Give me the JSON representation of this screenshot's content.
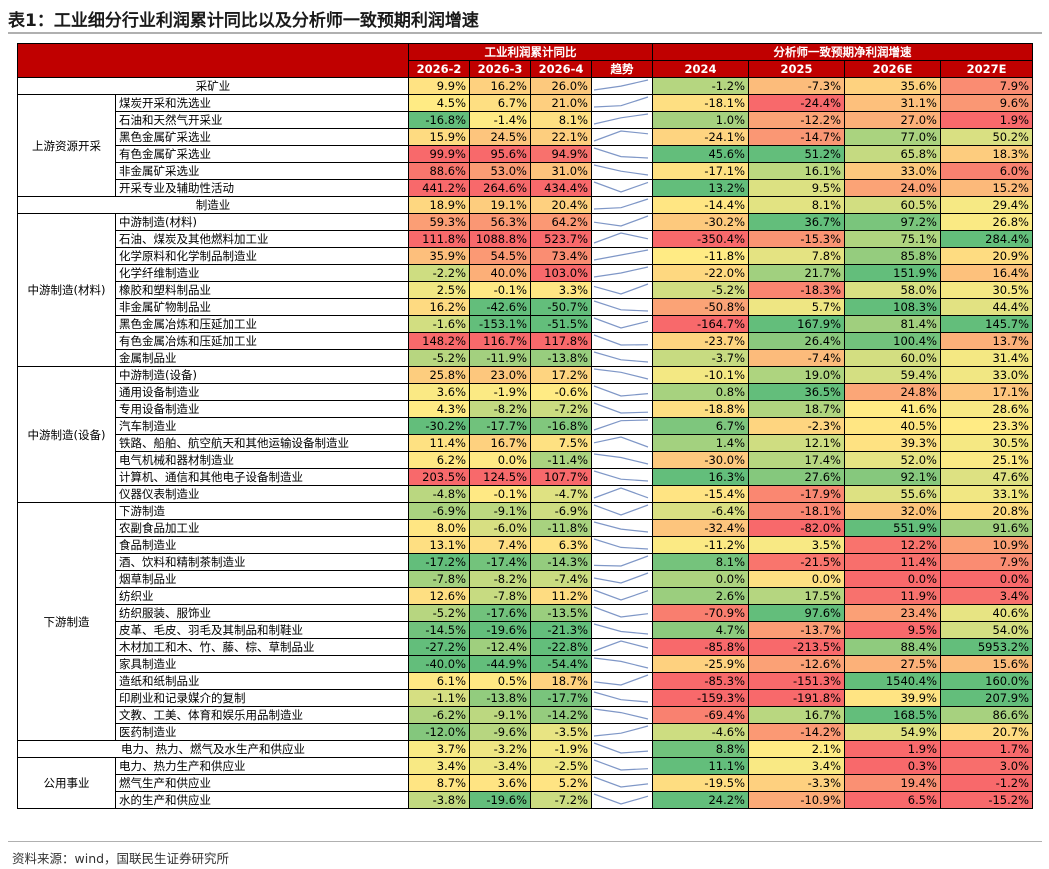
{
  "title": "表1：工业细分行业利润累计同比以及分析师一致预期利润增速",
  "source": "资料来源：wind，国联民生证券研究所",
  "header": {
    "profit_group": "工业利润累计同比",
    "analyst_group": "分析师一致预期净利润增速",
    "columns": [
      "2026-2",
      "2026-3",
      "2026-4",
      "趋势",
      "2024",
      "2025",
      "2026E",
      "2027E"
    ]
  },
  "colors": {
    "header_red": "#c00000",
    "scale_red": "#f8696b",
    "scale_yellow": "#ffeb84",
    "scale_green": "#63be7b",
    "sparkline": "#7f97c7"
  },
  "rows": [
    {
      "total": "采矿业",
      "v": [
        "9.9%",
        "16.2%",
        "26.0%"
      ],
      "a": [
        "-1.2%",
        "-7.3%",
        "35.6%",
        "7.9%"
      ]
    },
    {
      "group": "上游资源开采",
      "span": 6,
      "name": "煤炭开采和洗选业",
      "v": [
        "4.5%",
        "6.7%",
        "21.0%"
      ],
      "a": [
        "-18.1%",
        "-24.4%",
        "31.1%",
        "9.6%"
      ]
    },
    {
      "name": "石油和天然气开采业",
      "v": [
        "-16.8%",
        "-1.4%",
        "8.1%"
      ],
      "a": [
        "1.0%",
        "-12.2%",
        "27.0%",
        "1.9%"
      ]
    },
    {
      "name": "黑色金属矿采选业",
      "v": [
        "15.9%",
        "24.5%",
        "22.1%"
      ],
      "a": [
        "-24.1%",
        "-14.7%",
        "77.0%",
        "50.2%"
      ]
    },
    {
      "name": "有色金属矿采选业",
      "v": [
        "99.9%",
        "95.6%",
        "94.9%"
      ],
      "a": [
        "45.6%",
        "51.2%",
        "65.8%",
        "18.3%"
      ]
    },
    {
      "name": "非金属矿采选业",
      "v": [
        "88.6%",
        "53.0%",
        "31.0%"
      ],
      "a": [
        "-17.1%",
        "16.1%",
        "33.0%",
        "6.0%"
      ]
    },
    {
      "name": "开采专业及辅助性活动",
      "v": [
        "441.2%",
        "264.6%",
        "434.4%"
      ],
      "a": [
        "13.2%",
        "9.5%",
        "24.0%",
        "15.2%"
      ]
    },
    {
      "total": "制造业",
      "v": [
        "18.9%",
        "19.1%",
        "20.4%"
      ],
      "a": [
        "-14.4%",
        "8.1%",
        "60.5%",
        "29.4%"
      ]
    },
    {
      "group": "中游制造(材料)",
      "span": 9,
      "name": "中游制造(材料)",
      "v": [
        "59.3%",
        "56.3%",
        "64.2%"
      ],
      "a": [
        "-30.2%",
        "36.7%",
        "97.2%",
        "26.8%"
      ]
    },
    {
      "name": "石油、煤炭及其他燃料加工业",
      "v": [
        "111.8%",
        "1088.8%",
        "523.7%"
      ],
      "a": [
        "-350.4%",
        "-15.3%",
        "75.1%",
        "284.4%"
      ]
    },
    {
      "name": "化学原料和化学制品制造业",
      "v": [
        "35.9%",
        "54.5%",
        "73.4%"
      ],
      "a": [
        "-11.8%",
        "7.8%",
        "85.8%",
        "20.9%"
      ]
    },
    {
      "name": "化学纤维制造业",
      "v": [
        "-2.2%",
        "40.0%",
        "103.0%"
      ],
      "a": [
        "-22.0%",
        "21.7%",
        "151.9%",
        "16.4%"
      ]
    },
    {
      "name": "橡胶和塑料制品业",
      "v": [
        "2.5%",
        "-0.1%",
        "3.3%"
      ],
      "a": [
        "-5.2%",
        "-18.3%",
        "58.0%",
        "30.5%"
      ]
    },
    {
      "name": "非金属矿物制品业",
      "v": [
        "16.2%",
        "-42.6%",
        "-50.7%"
      ],
      "a": [
        "-50.8%",
        "5.7%",
        "108.3%",
        "44.4%"
      ]
    },
    {
      "name": "黑色金属冶炼和压延加工业",
      "v": [
        "-1.6%",
        "-153.1%",
        "-51.5%"
      ],
      "a": [
        "-164.7%",
        "167.9%",
        "81.4%",
        "145.7%"
      ]
    },
    {
      "name": "有色金属冶炼和压延加工业",
      "v": [
        "148.2%",
        "116.7%",
        "117.8%"
      ],
      "a": [
        "-23.7%",
        "26.4%",
        "100.4%",
        "13.7%"
      ]
    },
    {
      "name": "金属制品业",
      "v": [
        "-5.2%",
        "-11.9%",
        "-13.8%"
      ],
      "a": [
        "-3.7%",
        "-7.4%",
        "60.0%",
        "31.4%"
      ]
    },
    {
      "group": "中游制造(设备)",
      "span": 8,
      "name": "中游制造(设备)",
      "v": [
        "25.8%",
        "23.0%",
        "17.2%"
      ],
      "a": [
        "-10.1%",
        "19.0%",
        "59.4%",
        "33.0%"
      ]
    },
    {
      "name": "通用设备制造业",
      "v": [
        "3.6%",
        "-1.9%",
        "-0.6%"
      ],
      "a": [
        "0.8%",
        "36.5%",
        "24.8%",
        "17.1%"
      ]
    },
    {
      "name": "专用设备制造业",
      "v": [
        "4.3%",
        "-8.2%",
        "-7.2%"
      ],
      "a": [
        "-18.8%",
        "18.7%",
        "41.6%",
        "28.6%"
      ]
    },
    {
      "name": "汽车制造业",
      "v": [
        "-30.2%",
        "-17.7%",
        "-16.8%"
      ],
      "a": [
        "6.7%",
        "-2.3%",
        "40.5%",
        "23.3%"
      ]
    },
    {
      "name": "铁路、船舶、航空航天和其他运输设备制造业",
      "v": [
        "11.4%",
        "16.7%",
        "7.5%"
      ],
      "a": [
        "1.4%",
        "12.1%",
        "39.3%",
        "30.5%"
      ]
    },
    {
      "name": "电气机械和器材制造业",
      "v": [
        "6.2%",
        "0.0%",
        "-11.4%"
      ],
      "a": [
        "-30.0%",
        "17.4%",
        "52.0%",
        "25.1%"
      ]
    },
    {
      "name": "计算机、通信和其他电子设备制造业",
      "v": [
        "203.5%",
        "124.5%",
        "107.7%"
      ],
      "a": [
        "16.3%",
        "27.6%",
        "92.1%",
        "47.6%"
      ]
    },
    {
      "name": "仪器仪表制造业",
      "v": [
        "-4.8%",
        "-0.1%",
        "-4.7%"
      ],
      "a": [
        "-15.4%",
        "-17.9%",
        "55.6%",
        "33.1%"
      ]
    },
    {
      "group": "下游制造",
      "span": 14,
      "name": "下游制造",
      "v": [
        "-6.9%",
        "-9.1%",
        "-6.9%"
      ],
      "a": [
        "-6.4%",
        "-18.1%",
        "32.0%",
        "20.8%"
      ]
    },
    {
      "name": "农副食品加工业",
      "v": [
        "8.0%",
        "-6.0%",
        "-11.8%"
      ],
      "a": [
        "-32.4%",
        "-82.0%",
        "551.9%",
        "91.6%"
      ]
    },
    {
      "name": "食品制造业",
      "v": [
        "13.1%",
        "7.4%",
        "6.3%"
      ],
      "a": [
        "-11.2%",
        "3.5%",
        "12.2%",
        "10.9%"
      ]
    },
    {
      "name": "酒、饮料和精制茶制造业",
      "v": [
        "-17.2%",
        "-17.4%",
        "-14.3%"
      ],
      "a": [
        "8.1%",
        "-21.5%",
        "11.4%",
        "7.9%"
      ]
    },
    {
      "name": "烟草制品业",
      "v": [
        "-7.8%",
        "-8.2%",
        "-7.4%"
      ],
      "a": [
        "0.0%",
        "0.0%",
        "0.0%",
        "0.0%"
      ]
    },
    {
      "name": "纺织业",
      "v": [
        "12.6%",
        "-7.8%",
        "11.2%"
      ],
      "a": [
        "2.6%",
        "17.5%",
        "11.9%",
        "3.4%"
      ]
    },
    {
      "name": "纺织服装、服饰业",
      "v": [
        "-5.2%",
        "-17.6%",
        "-13.5%"
      ],
      "a": [
        "-70.9%",
        "97.6%",
        "23.4%",
        "40.6%"
      ]
    },
    {
      "name": "皮革、毛皮、羽毛及其制品和制鞋业",
      "v": [
        "-14.5%",
        "-19.6%",
        "-21.3%"
      ],
      "a": [
        "4.7%",
        "-13.7%",
        "9.5%",
        "54.0%"
      ]
    },
    {
      "name": "木材加工和木、竹、藤、棕、草制品业",
      "v": [
        "-27.2%",
        "-12.4%",
        "-22.8%"
      ],
      "a": [
        "-85.8%",
        "-213.5%",
        "88.4%",
        "5953.2%"
      ]
    },
    {
      "name": "家具制造业",
      "v": [
        "-40.0%",
        "-44.9%",
        "-54.4%"
      ],
      "a": [
        "-25.9%",
        "-12.6%",
        "27.5%",
        "15.6%"
      ]
    },
    {
      "name": "造纸和纸制品业",
      "v": [
        "6.1%",
        "0.5%",
        "18.7%"
      ],
      "a": [
        "-85.3%",
        "-151.3%",
        "1540.4%",
        "160.0%"
      ]
    },
    {
      "name": "印刷业和记录媒介的复制",
      "v": [
        "-1.1%",
        "-13.8%",
        "-17.7%"
      ],
      "a": [
        "-159.3%",
        "-191.8%",
        "39.9%",
        "207.9%"
      ]
    },
    {
      "name": "文教、工美、体育和娱乐用品制造业",
      "v": [
        "-6.2%",
        "-9.1%",
        "-14.2%"
      ],
      "a": [
        "-69.4%",
        "16.7%",
        "168.5%",
        "86.6%"
      ]
    },
    {
      "name": "医药制造业",
      "v": [
        "-12.0%",
        "-9.6%",
        "-3.5%"
      ],
      "a": [
        "-4.6%",
        "-14.2%",
        "54.9%",
        "20.7%"
      ]
    },
    {
      "total": "电力、热力、燃气及水生产和供应业",
      "v": [
        "3.7%",
        "-3.2%",
        "-1.9%"
      ],
      "a": [
        "8.8%",
        "2.1%",
        "1.9%",
        "1.7%"
      ]
    },
    {
      "group": "公用事业",
      "span": 3,
      "name": "电力、热力生产和供应业",
      "v": [
        "3.4%",
        "-3.4%",
        "-2.5%"
      ],
      "a": [
        "11.1%",
        "3.4%",
        "0.3%",
        "3.0%"
      ]
    },
    {
      "name": "燃气生产和供应业",
      "v": [
        "8.7%",
        "3.6%",
        "5.2%"
      ],
      "a": [
        "-19.5%",
        "-3.3%",
        "19.4%",
        "-1.2%"
      ]
    },
    {
      "name": "水的生产和供应业",
      "v": [
        "-3.8%",
        "-19.6%",
        "-7.2%"
      ],
      "a": [
        "24.2%",
        "-10.9%",
        "6.5%",
        "-15.2%"
      ]
    }
  ]
}
